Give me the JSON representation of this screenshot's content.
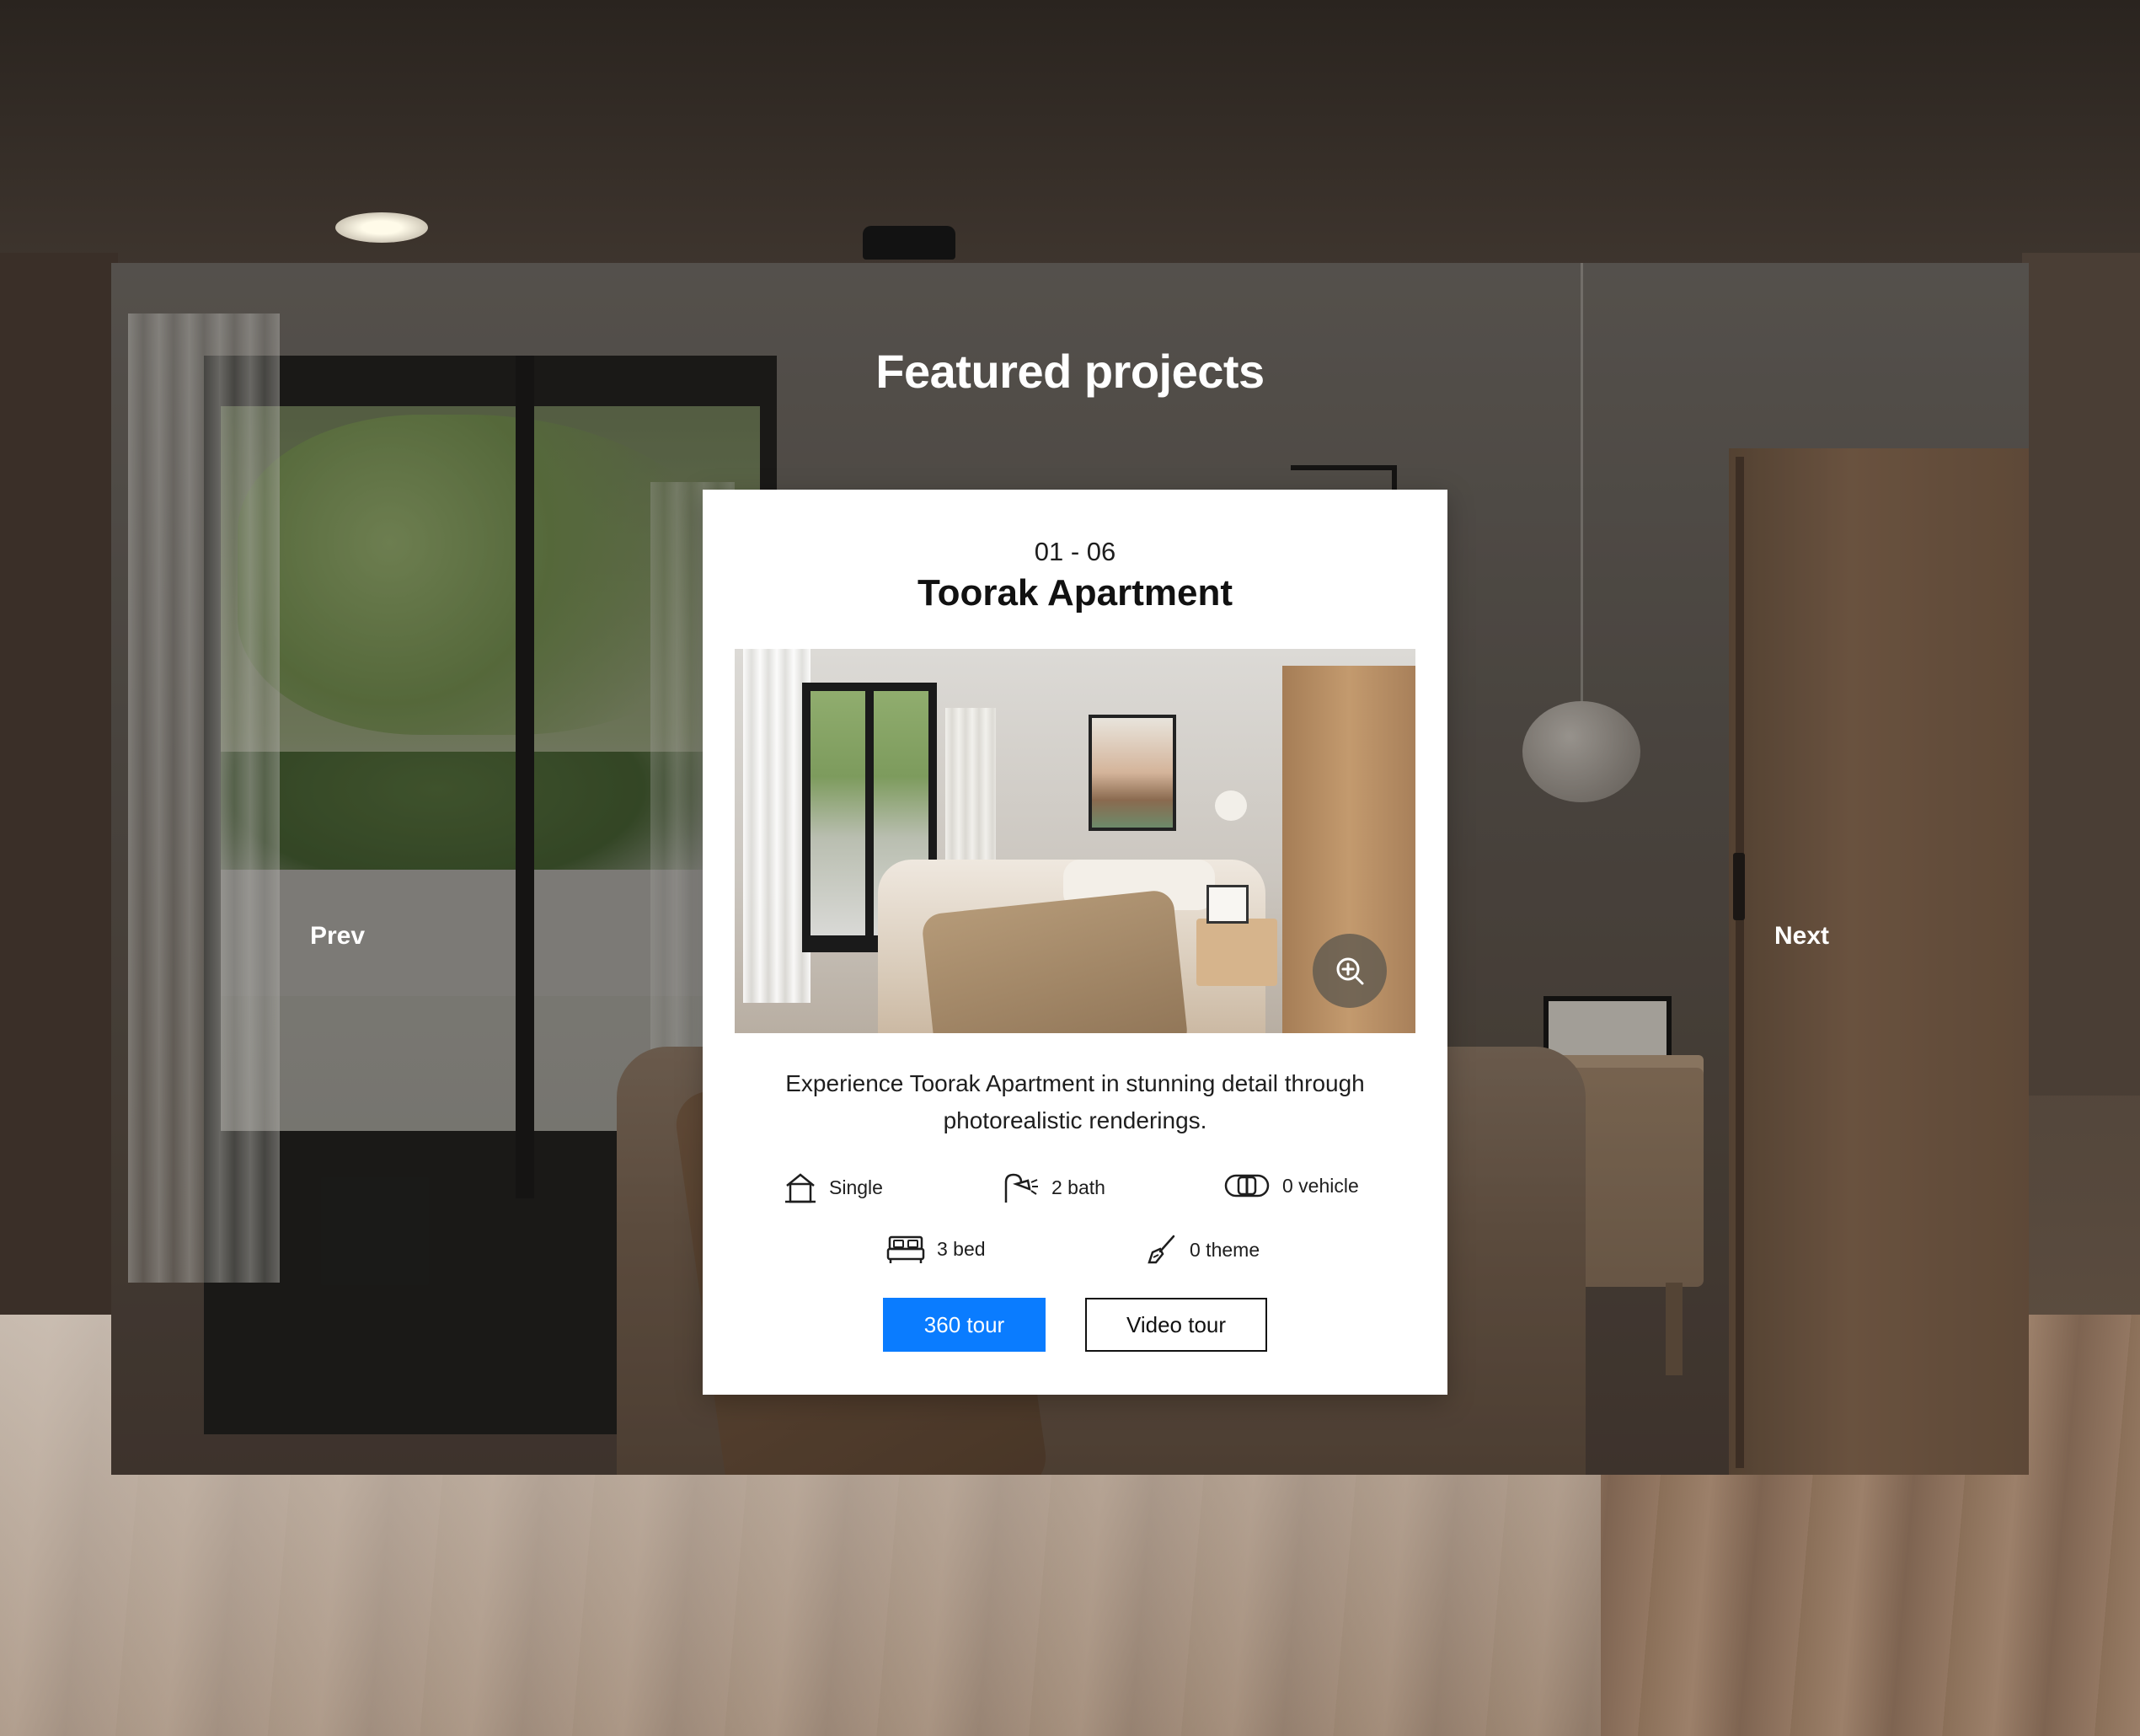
{
  "page": {
    "headline": "Featured projects",
    "nav": {
      "prev_label": "Prev",
      "next_label": "Next"
    }
  },
  "card": {
    "counter": "01 - 06",
    "title": "Toorak Apartment",
    "description": "Experience Toorak Apartment in stunning detail through photorealistic renderings.",
    "zoom_icon": "zoom-in-icon",
    "features": {
      "type": {
        "icon": "house-icon",
        "label": "Single"
      },
      "bath": {
        "icon": "shower-icon",
        "label": "2 bath"
      },
      "vehicle": {
        "icon": "car-icon",
        "label": "0 vehicle"
      },
      "bed": {
        "icon": "bed-icon",
        "label": "3 bed"
      },
      "theme": {
        "icon": "brush-icon",
        "label": "0 theme"
      }
    },
    "buttons": {
      "tour_360": "360 tour",
      "video_tour": "Video tour"
    }
  },
  "colors": {
    "primary_button": "#0a7cff",
    "card_background": "#ffffff",
    "text_dark": "#111111"
  }
}
